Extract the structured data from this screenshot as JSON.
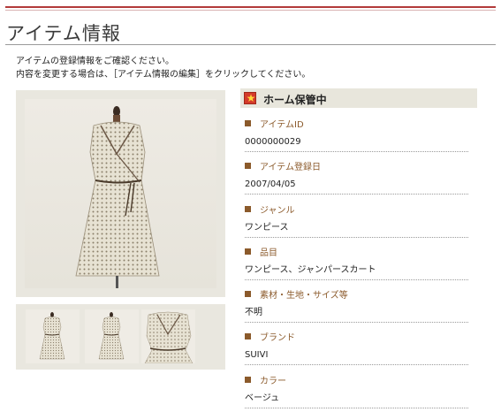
{
  "page": {
    "title": "アイテム情報",
    "intro_line1": "アイテムの登録情報をご確認ください。",
    "intro_line2": "内容を変更する場合は、［アイテム情報の編集］をクリックしてください。"
  },
  "status": {
    "icon": "star-icon",
    "label": "ホーム保管中"
  },
  "fields": [
    {
      "label": "アイテムID",
      "value": "0000000029"
    },
    {
      "label": "アイテム登録日",
      "value": "2007/04/05"
    },
    {
      "label": "ジャンル",
      "value": "ワンピース"
    },
    {
      "label": "品目",
      "value": "ワンピース、ジャンパースカート"
    },
    {
      "label": "素材・生地・サイズ等",
      "value": "不明"
    },
    {
      "label": "ブランド",
      "value": "SUIVI"
    },
    {
      "label": "カラー",
      "value": "ベージュ"
    }
  ],
  "colors": {
    "accent_red": "#b23a3a",
    "label_brown": "#8b5a2b",
    "status_bg": "#e8e6dc"
  }
}
